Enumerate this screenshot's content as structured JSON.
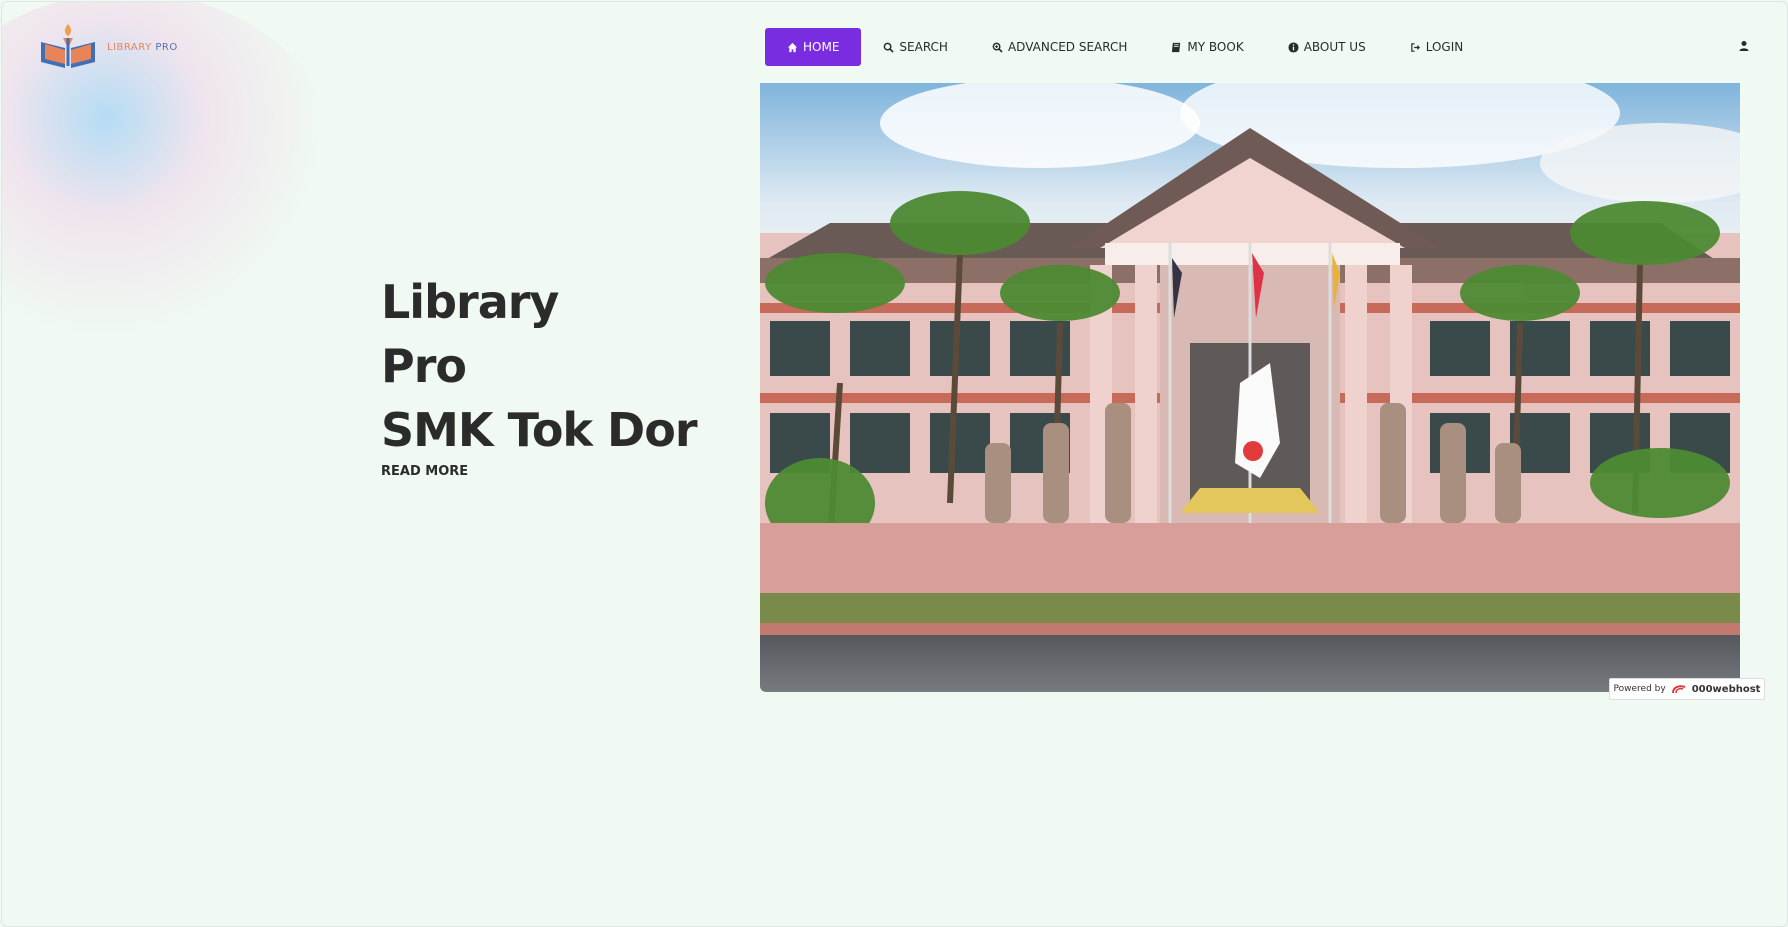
{
  "brand": {
    "name_part1": "LIBRARY",
    "name_part2": "PRO",
    "accent": "#7a2de0"
  },
  "nav": {
    "items": [
      {
        "label": "HOME",
        "icon": "home-icon",
        "active": true
      },
      {
        "label": "SEARCH",
        "icon": "search-icon"
      },
      {
        "label": "ADVANCED SEARCH",
        "icon": "advanced-search-icon"
      },
      {
        "label": "MY BOOK",
        "icon": "book-icon"
      },
      {
        "label": "ABOUT US",
        "icon": "info-icon"
      },
      {
        "label": "LOGIN",
        "icon": "login-icon"
      }
    ],
    "user_icon": "user-icon"
  },
  "hero": {
    "title_line1": "Library",
    "title_line2": "Pro",
    "title_line3": "SMK Tok Dor",
    "read_more": "READ MORE",
    "image": "school-building-photo"
  },
  "footer_badge": {
    "prefix": "Powered by",
    "brand": "000webhost"
  }
}
